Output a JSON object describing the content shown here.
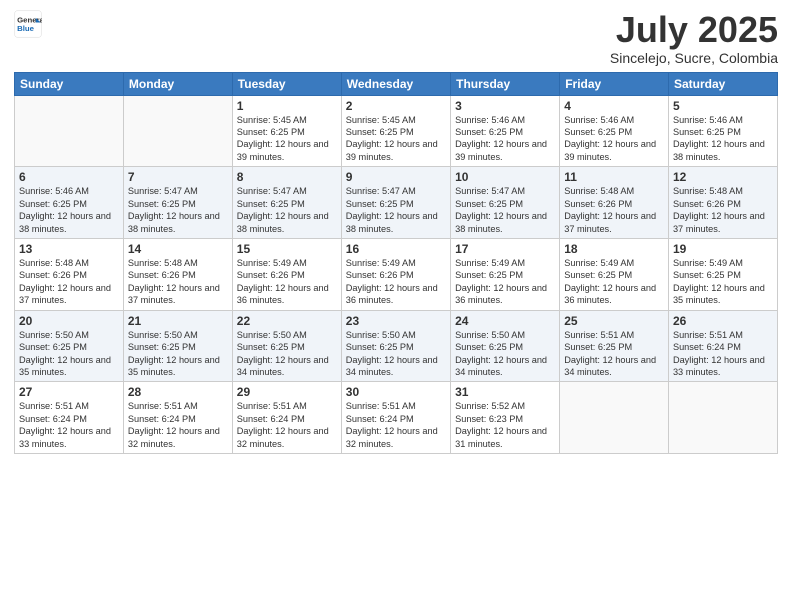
{
  "header": {
    "logo_line1": "General",
    "logo_line2": "Blue",
    "main_title": "July 2025",
    "sub_title": "Sincelejo, Sucre, Colombia"
  },
  "days_of_week": [
    "Sunday",
    "Monday",
    "Tuesday",
    "Wednesday",
    "Thursday",
    "Friday",
    "Saturday"
  ],
  "weeks": [
    [
      {
        "num": "",
        "info": ""
      },
      {
        "num": "",
        "info": ""
      },
      {
        "num": "1",
        "info": "Sunrise: 5:45 AM\nSunset: 6:25 PM\nDaylight: 12 hours and 39 minutes."
      },
      {
        "num": "2",
        "info": "Sunrise: 5:45 AM\nSunset: 6:25 PM\nDaylight: 12 hours and 39 minutes."
      },
      {
        "num": "3",
        "info": "Sunrise: 5:46 AM\nSunset: 6:25 PM\nDaylight: 12 hours and 39 minutes."
      },
      {
        "num": "4",
        "info": "Sunrise: 5:46 AM\nSunset: 6:25 PM\nDaylight: 12 hours and 39 minutes."
      },
      {
        "num": "5",
        "info": "Sunrise: 5:46 AM\nSunset: 6:25 PM\nDaylight: 12 hours and 38 minutes."
      }
    ],
    [
      {
        "num": "6",
        "info": "Sunrise: 5:46 AM\nSunset: 6:25 PM\nDaylight: 12 hours and 38 minutes."
      },
      {
        "num": "7",
        "info": "Sunrise: 5:47 AM\nSunset: 6:25 PM\nDaylight: 12 hours and 38 minutes."
      },
      {
        "num": "8",
        "info": "Sunrise: 5:47 AM\nSunset: 6:25 PM\nDaylight: 12 hours and 38 minutes."
      },
      {
        "num": "9",
        "info": "Sunrise: 5:47 AM\nSunset: 6:25 PM\nDaylight: 12 hours and 38 minutes."
      },
      {
        "num": "10",
        "info": "Sunrise: 5:47 AM\nSunset: 6:25 PM\nDaylight: 12 hours and 38 minutes."
      },
      {
        "num": "11",
        "info": "Sunrise: 5:48 AM\nSunset: 6:26 PM\nDaylight: 12 hours and 37 minutes."
      },
      {
        "num": "12",
        "info": "Sunrise: 5:48 AM\nSunset: 6:26 PM\nDaylight: 12 hours and 37 minutes."
      }
    ],
    [
      {
        "num": "13",
        "info": "Sunrise: 5:48 AM\nSunset: 6:26 PM\nDaylight: 12 hours and 37 minutes."
      },
      {
        "num": "14",
        "info": "Sunrise: 5:48 AM\nSunset: 6:26 PM\nDaylight: 12 hours and 37 minutes."
      },
      {
        "num": "15",
        "info": "Sunrise: 5:49 AM\nSunset: 6:26 PM\nDaylight: 12 hours and 36 minutes."
      },
      {
        "num": "16",
        "info": "Sunrise: 5:49 AM\nSunset: 6:26 PM\nDaylight: 12 hours and 36 minutes."
      },
      {
        "num": "17",
        "info": "Sunrise: 5:49 AM\nSunset: 6:25 PM\nDaylight: 12 hours and 36 minutes."
      },
      {
        "num": "18",
        "info": "Sunrise: 5:49 AM\nSunset: 6:25 PM\nDaylight: 12 hours and 36 minutes."
      },
      {
        "num": "19",
        "info": "Sunrise: 5:49 AM\nSunset: 6:25 PM\nDaylight: 12 hours and 35 minutes."
      }
    ],
    [
      {
        "num": "20",
        "info": "Sunrise: 5:50 AM\nSunset: 6:25 PM\nDaylight: 12 hours and 35 minutes."
      },
      {
        "num": "21",
        "info": "Sunrise: 5:50 AM\nSunset: 6:25 PM\nDaylight: 12 hours and 35 minutes."
      },
      {
        "num": "22",
        "info": "Sunrise: 5:50 AM\nSunset: 6:25 PM\nDaylight: 12 hours and 34 minutes."
      },
      {
        "num": "23",
        "info": "Sunrise: 5:50 AM\nSunset: 6:25 PM\nDaylight: 12 hours and 34 minutes."
      },
      {
        "num": "24",
        "info": "Sunrise: 5:50 AM\nSunset: 6:25 PM\nDaylight: 12 hours and 34 minutes."
      },
      {
        "num": "25",
        "info": "Sunrise: 5:51 AM\nSunset: 6:25 PM\nDaylight: 12 hours and 34 minutes."
      },
      {
        "num": "26",
        "info": "Sunrise: 5:51 AM\nSunset: 6:24 PM\nDaylight: 12 hours and 33 minutes."
      }
    ],
    [
      {
        "num": "27",
        "info": "Sunrise: 5:51 AM\nSunset: 6:24 PM\nDaylight: 12 hours and 33 minutes."
      },
      {
        "num": "28",
        "info": "Sunrise: 5:51 AM\nSunset: 6:24 PM\nDaylight: 12 hours and 32 minutes."
      },
      {
        "num": "29",
        "info": "Sunrise: 5:51 AM\nSunset: 6:24 PM\nDaylight: 12 hours and 32 minutes."
      },
      {
        "num": "30",
        "info": "Sunrise: 5:51 AM\nSunset: 6:24 PM\nDaylight: 12 hours and 32 minutes."
      },
      {
        "num": "31",
        "info": "Sunrise: 5:52 AM\nSunset: 6:23 PM\nDaylight: 12 hours and 31 minutes."
      },
      {
        "num": "",
        "info": ""
      },
      {
        "num": "",
        "info": ""
      }
    ]
  ]
}
